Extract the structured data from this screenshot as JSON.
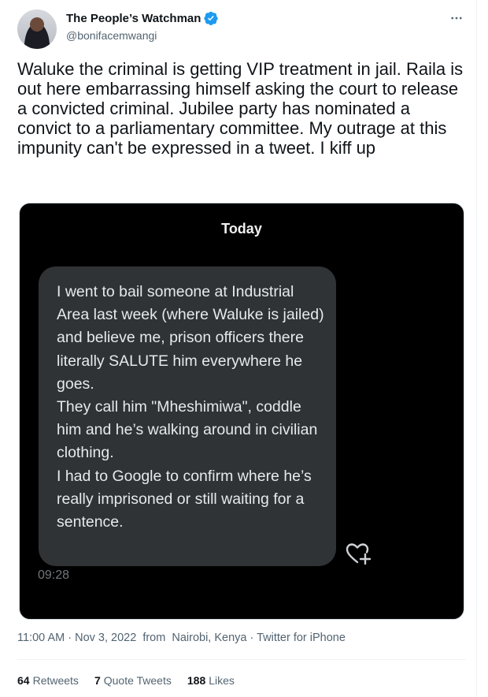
{
  "user": {
    "display_name": "The People’s Watchman",
    "handle": "@bonifacemwangi",
    "verified_icon": "verified-badge-icon",
    "verified_color": "#1d9bf0"
  },
  "more_icon": "more-horizontal-icon",
  "tweet": {
    "text": "Waluke the criminal is getting VIP treatment in jail. Raila is out here embarrassing himself asking the court to release a convicted criminal. Jubilee party has nominated a convict to a parliamentary committee. My outrage at this impunity can't be expressed in a tweet. I kiff up"
  },
  "media": {
    "day_label": "Today",
    "message_text": "I went to bail someone at Industrial Area last week (where Waluke is jailed) and believe me, prison officers there literally SALUTE him everywhere he goes.\nThey call him \"Mheshimiwa\", coddle him and he’s walking around in civilian clothing.\nI had to Google to confirm where he’s really imprisoned or still waiting for a sentence.",
    "message_time": "09:28",
    "react_icon": "heart-add-icon"
  },
  "meta": {
    "time": "11:00 AM",
    "date": "Nov 3, 2022",
    "location_prefix": "from",
    "location": "Nairobi, Kenya",
    "source": "Twitter for iPhone"
  },
  "stats": {
    "retweets_count": "64",
    "retweets_label": "Retweets",
    "quotes_count": "7",
    "quotes_label": "Quote Tweets",
    "likes_count": "188",
    "likes_label": "Likes"
  }
}
